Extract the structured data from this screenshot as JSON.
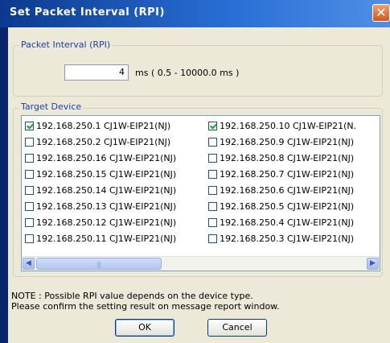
{
  "window": {
    "title": "Set Packet Interval (RPI)",
    "close_glyph": "✕"
  },
  "packet_interval": {
    "group_label": "Packet Interval (RPI)",
    "value": "4",
    "unit_range": "ms ( 0.5 - 10000.0 ms )"
  },
  "target_device": {
    "group_label": "Target Device",
    "left_column": [
      {
        "label": "192.168.250.1 CJ1W-EIP21(NJ)",
        "checked": true
      },
      {
        "label": "192.168.250.2 CJ1W-EIP21(NJ)",
        "checked": false
      },
      {
        "label": "192.168.250.16 CJ1W-EIP21(NJ)",
        "checked": false
      },
      {
        "label": "192.168.250.15 CJ1W-EIP21(NJ)",
        "checked": false
      },
      {
        "label": "192.168.250.14 CJ1W-EIP21(NJ)",
        "checked": false
      },
      {
        "label": "192.168.250.13 CJ1W-EIP21(NJ)",
        "checked": false
      },
      {
        "label": "192.168.250.12 CJ1W-EIP21(NJ)",
        "checked": false
      },
      {
        "label": "192.168.250.11 CJ1W-EIP21(NJ)",
        "checked": false
      }
    ],
    "right_column": [
      {
        "label": "192.168.250.10 CJ1W-EIP21(N.",
        "checked": true
      },
      {
        "label": "192.168.250.9 CJ1W-EIP21(NJ)",
        "checked": false
      },
      {
        "label": "192.168.250.8 CJ1W-EIP21(NJ)",
        "checked": false
      },
      {
        "label": "192.168.250.7 CJ1W-EIP21(NJ)",
        "checked": false
      },
      {
        "label": "192.168.250.6 CJ1W-EIP21(NJ)",
        "checked": false
      },
      {
        "label": "192.168.250.5 CJ1W-EIP21(NJ)",
        "checked": false
      },
      {
        "label": "192.168.250.4 CJ1W-EIP21(NJ)",
        "checked": false
      },
      {
        "label": "192.168.250.3 CJ1W-EIP21(NJ)",
        "checked": false
      }
    ],
    "scroll_left_glyph": "◀",
    "scroll_right_glyph": "▶",
    "scroll_grip": "|||"
  },
  "note": {
    "line1": "NOTE : Possible RPI value depends on the device type.",
    "line2": "Please confirm the setting result on message report window."
  },
  "buttons": {
    "ok": "OK",
    "cancel": "Cancel"
  }
}
